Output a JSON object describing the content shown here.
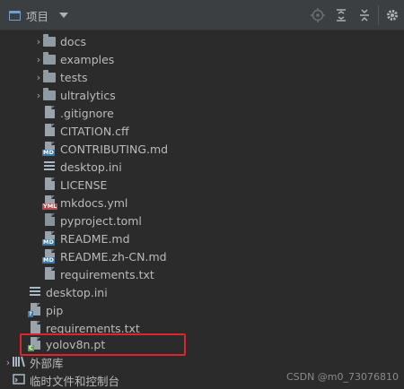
{
  "toolbar": {
    "title": "项目",
    "icons": [
      "locate-icon",
      "expand-all-icon",
      "collapse-all-icon",
      "gear-icon"
    ]
  },
  "tree": [
    {
      "label": "docs",
      "kind": "folder",
      "expandable": true,
      "indent": 1
    },
    {
      "label": "examples",
      "kind": "folder",
      "expandable": true,
      "indent": 1
    },
    {
      "label": "tests",
      "kind": "folder",
      "expandable": true,
      "indent": 1
    },
    {
      "label": "ultralytics",
      "kind": "folder",
      "expandable": true,
      "indent": 1
    },
    {
      "label": ".gitignore",
      "kind": "file",
      "indent": 1
    },
    {
      "label": "CITATION.cff",
      "kind": "file",
      "indent": 1
    },
    {
      "label": "CONTRIBUTING.md",
      "kind": "md",
      "indent": 1
    },
    {
      "label": "desktop.ini",
      "kind": "ini",
      "indent": 1
    },
    {
      "label": "LICENSE",
      "kind": "file",
      "indent": 1
    },
    {
      "label": "mkdocs.yml",
      "kind": "yml",
      "indent": 1
    },
    {
      "label": "pyproject.toml",
      "kind": "toml",
      "indent": 1
    },
    {
      "label": "README.md",
      "kind": "md",
      "indent": 1
    },
    {
      "label": "README.zh-CN.md",
      "kind": "md",
      "indent": 1
    },
    {
      "label": "requirements.txt",
      "kind": "txt",
      "indent": 1
    },
    {
      "label": "desktop.ini",
      "kind": "ini",
      "indent": 0
    },
    {
      "label": "pip",
      "kind": "pip",
      "indent": 0
    },
    {
      "label": "requirements.txt",
      "kind": "txt",
      "indent": 0
    },
    {
      "label": "yolov8n.pt",
      "kind": "pt",
      "indent": 0
    },
    {
      "label": "外部库",
      "kind": "lib",
      "expandable": true,
      "indent": -1
    },
    {
      "label": "临时文件和控制台",
      "kind": "scratch",
      "expandable": false,
      "indent": -1
    }
  ],
  "watermark": "CSDN @m0_73076810",
  "colors": {
    "highlight": "#e0242b",
    "background": "#2b2b2b"
  }
}
